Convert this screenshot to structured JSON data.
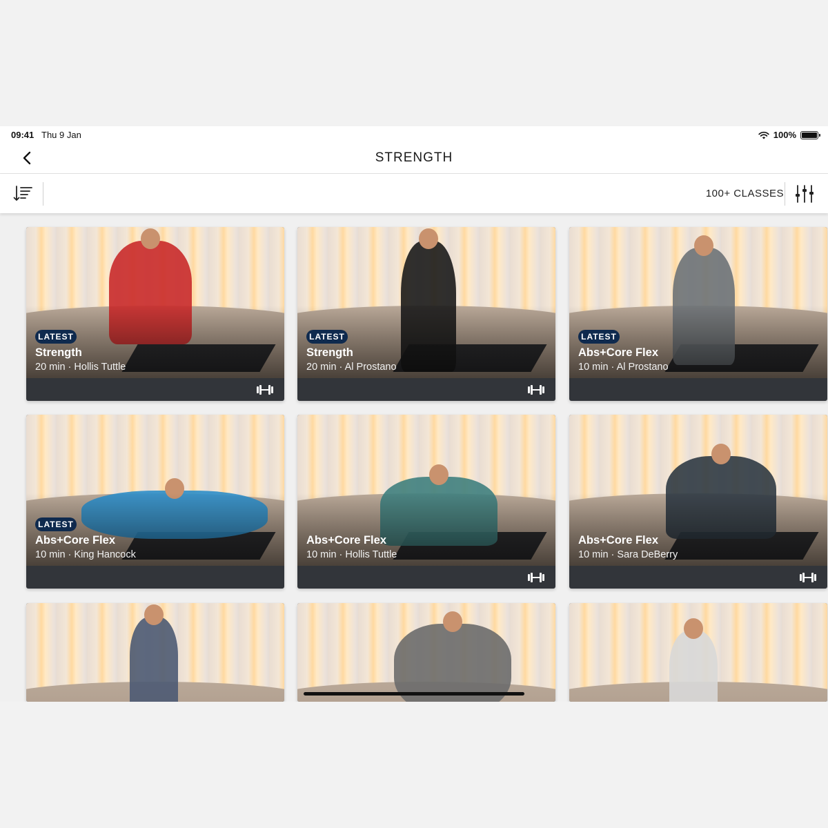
{
  "status_bar": {
    "time": "09:41",
    "date": "Thu 9 Jan",
    "battery": "100%"
  },
  "header": {
    "title": "STRENGTH"
  },
  "toolbar": {
    "class_count": "100+ CLASSES"
  },
  "icons": {
    "back": "chevron-left-icon",
    "sort": "sort-icon",
    "filter": "sliders-icon",
    "wifi": "wifi-icon",
    "equipment": "dumbbell-icon"
  },
  "cards": [
    {
      "badge": "LATEST",
      "title": "Strength",
      "subtitle": "20 min · Hollis Tuttle",
      "equipment": true
    },
    {
      "badge": "LATEST",
      "title": "Strength",
      "subtitle": "20 min · Al Prostano",
      "equipment": true
    },
    {
      "badge": "LATEST",
      "title": "Abs+Core Flex",
      "subtitle": "10 min · Al Prostano",
      "equipment": false
    },
    {
      "badge": "LATEST",
      "title": "Abs+Core Flex",
      "subtitle": "10 min · King Hancock",
      "equipment": false
    },
    {
      "badge": "",
      "title": "Abs+Core Flex",
      "subtitle": "10 min · Hollis Tuttle",
      "equipment": true
    },
    {
      "badge": "",
      "title": "Abs+Core Flex",
      "subtitle": "10 min · Sara DeBerry",
      "equipment": true
    },
    {
      "badge": "",
      "title": "",
      "subtitle": "",
      "equipment": false
    },
    {
      "badge": "",
      "title": "",
      "subtitle": "",
      "equipment": false
    },
    {
      "badge": "",
      "title": "",
      "subtitle": "",
      "equipment": false
    }
  ]
}
